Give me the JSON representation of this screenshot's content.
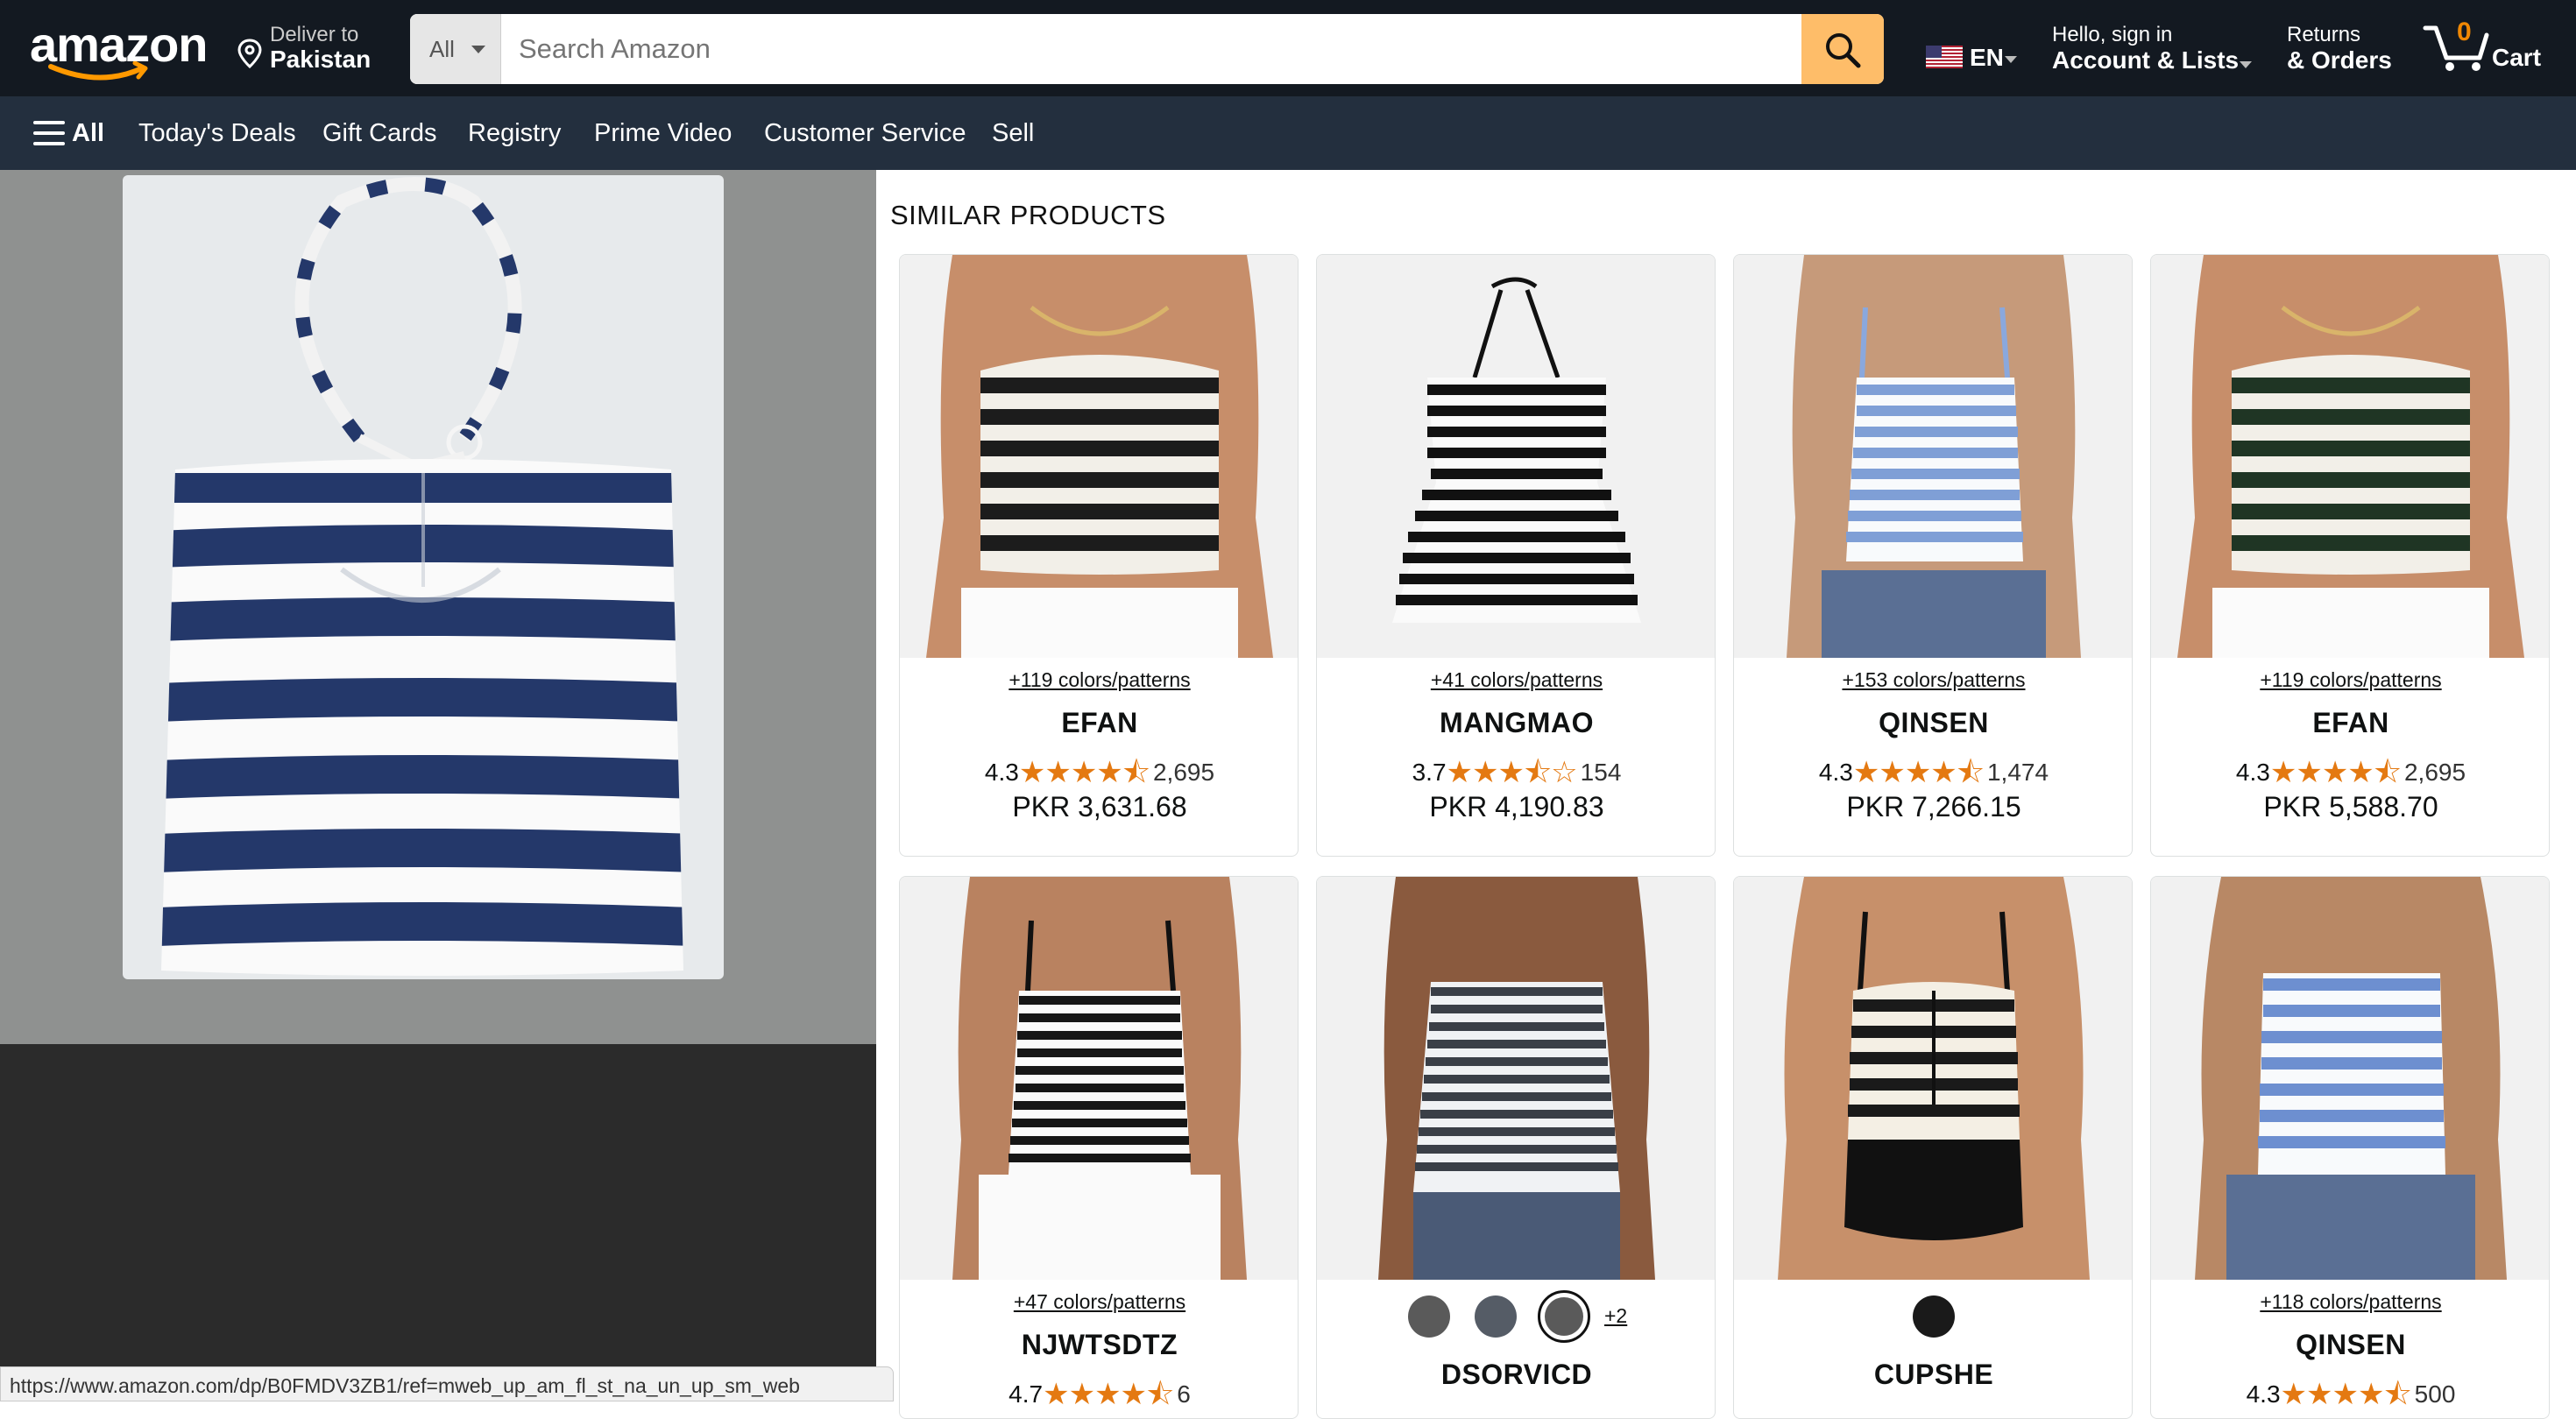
{
  "header": {
    "logo_text": "amazon",
    "deliver_label": "Deliver to",
    "deliver_location": "Pakistan",
    "search_category": "All",
    "search_placeholder": "Search Amazon",
    "language": "EN",
    "account_greeting": "Hello, sign in",
    "account_label": "Account & Lists",
    "returns_label": "Returns",
    "orders_label": "& Orders",
    "cart_count": "0",
    "cart_label": "Cart"
  },
  "subnav": {
    "all_label": "All",
    "items": [
      "Today's Deals",
      "Gift Cards",
      "Registry",
      "Prime Video",
      "Customer Service",
      "Sell"
    ]
  },
  "similar": {
    "title": "SIMILAR PRODUCTS",
    "products": [
      {
        "colors": "+119 colors/patterns",
        "brand": "EFAN",
        "rating": "4.3",
        "stars": "★★★★⯪",
        "reviews": "2,695",
        "price": "PKR 3,631.68",
        "stripe_color": "#1c1c1c"
      },
      {
        "colors": "+41 colors/patterns",
        "brand": "MANGMAO",
        "rating": "3.7",
        "stars": "★★★⯪☆",
        "reviews": "154",
        "price": "PKR 4,190.83",
        "stripe_color": "#111111"
      },
      {
        "colors": "+153 colors/patterns",
        "brand": "QINSEN",
        "rating": "4.3",
        "stars": "★★★★⯪",
        "reviews": "1,474",
        "price": "PKR 7,266.15",
        "stripe_color": "#7f9fd6"
      },
      {
        "colors": "+119 colors/patterns",
        "brand": "EFAN",
        "rating": "4.3",
        "stars": "★★★★⯪",
        "reviews": "2,695",
        "price": "PKR 5,588.70",
        "stripe_color": "#1f3524"
      },
      {
        "colors": "+47 colors/patterns",
        "brand": "NJWTSDTZ",
        "rating": "4.7",
        "stars": "★★★★⯪",
        "reviews": "6",
        "price": "",
        "stripe_color": "#161616"
      },
      {
        "colors": "+2",
        "brand": "DSORVICD",
        "rating": "",
        "stars": "",
        "reviews": "",
        "price": "",
        "stripe_color": "#3a3f47"
      },
      {
        "colors": "",
        "brand": "CUPSHE",
        "rating": "",
        "stars": "",
        "reviews": "",
        "price": "",
        "stripe_color": "#1a1a1a"
      },
      {
        "colors": "+118 colors/patterns",
        "brand": "QINSEN",
        "rating": "4.3",
        "stars": "★★★★⯪",
        "reviews": "500",
        "price": "",
        "stripe_color": "#6d8fd0"
      }
    ]
  },
  "status_url": "https://www.amazon.com/dp/B0FMDV3ZB1/ref=mweb_up_am_fl_st_na_un_up_sm_web",
  "colors": {
    "nav_bg": "#131921",
    "subnav_bg": "#232f3e",
    "search_button": "#febd69",
    "star": "#e47911",
    "main_image_stripe": "#24386a"
  }
}
